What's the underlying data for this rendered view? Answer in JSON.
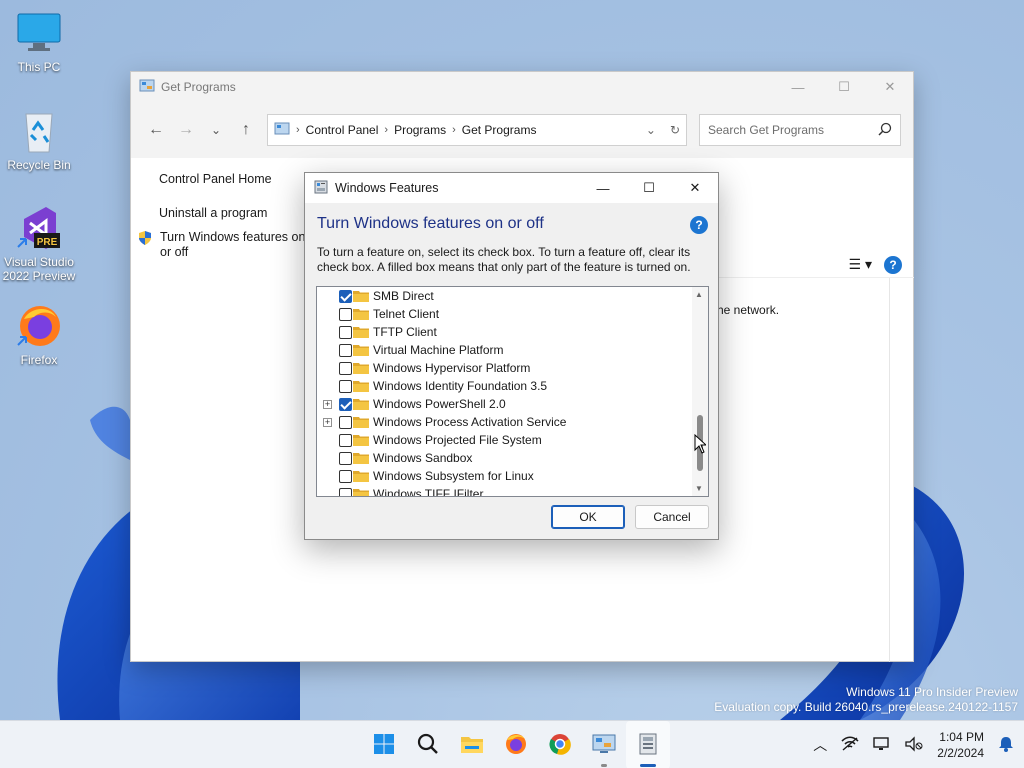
{
  "desktop": {
    "icons": [
      {
        "label": "This PC"
      },
      {
        "label": "Recycle Bin"
      },
      {
        "label": "Visual Studio 2022 Preview",
        "badge": "PRE"
      },
      {
        "label": "Firefox"
      }
    ],
    "watermark": {
      "line1": "Windows 11 Pro Insider Preview",
      "line2": "Evaluation copy. Build 26040.rs_prerelease.240122-1157"
    }
  },
  "explorer": {
    "title": "Get Programs",
    "breadcrumbs": [
      "Control Panel",
      "Programs",
      "Get Programs"
    ],
    "search_placeholder": "Search Get Programs",
    "left_links": {
      "home": "Control Panel Home",
      "uninstall": "Uninstall a program",
      "features": "Turn Windows features on or off"
    },
    "background_text": "he network."
  },
  "dialog": {
    "title": "Windows Features",
    "heading": "Turn Windows features on or off",
    "description": "To turn a feature on, select its check box. To turn a feature off, clear its check box. A filled box means that only part of the feature is turned on.",
    "features": [
      {
        "label": "SMB Direct",
        "checked": true,
        "expandable": false
      },
      {
        "label": "Telnet Client",
        "checked": false,
        "expandable": false
      },
      {
        "label": "TFTP Client",
        "checked": false,
        "expandable": false
      },
      {
        "label": "Virtual Machine Platform",
        "checked": false,
        "expandable": false
      },
      {
        "label": "Windows Hypervisor Platform",
        "checked": false,
        "expandable": false
      },
      {
        "label": "Windows Identity Foundation 3.5",
        "checked": false,
        "expandable": false
      },
      {
        "label": "Windows PowerShell 2.0",
        "checked": true,
        "expandable": true
      },
      {
        "label": "Windows Process Activation Service",
        "checked": false,
        "expandable": true
      },
      {
        "label": "Windows Projected File System",
        "checked": false,
        "expandable": false
      },
      {
        "label": "Windows Sandbox",
        "checked": false,
        "expandable": false
      },
      {
        "label": "Windows Subsystem for Linux",
        "checked": false,
        "expandable": false
      },
      {
        "label": "Windows TIFF IFilter",
        "checked": false,
        "expandable": false
      }
    ],
    "ok_label": "OK",
    "cancel_label": "Cancel"
  },
  "taskbar": {
    "apps": [
      "start-icon",
      "search-icon",
      "file-explorer-icon",
      "firefox-icon",
      "chrome-icon",
      "control-panel-icon",
      "windows-features-icon"
    ],
    "time": "1:04 PM",
    "date": "2/2/2024"
  },
  "colors": {
    "accent": "#1c5fb9",
    "heading": "#1e3287",
    "folder": "#f4c542"
  }
}
